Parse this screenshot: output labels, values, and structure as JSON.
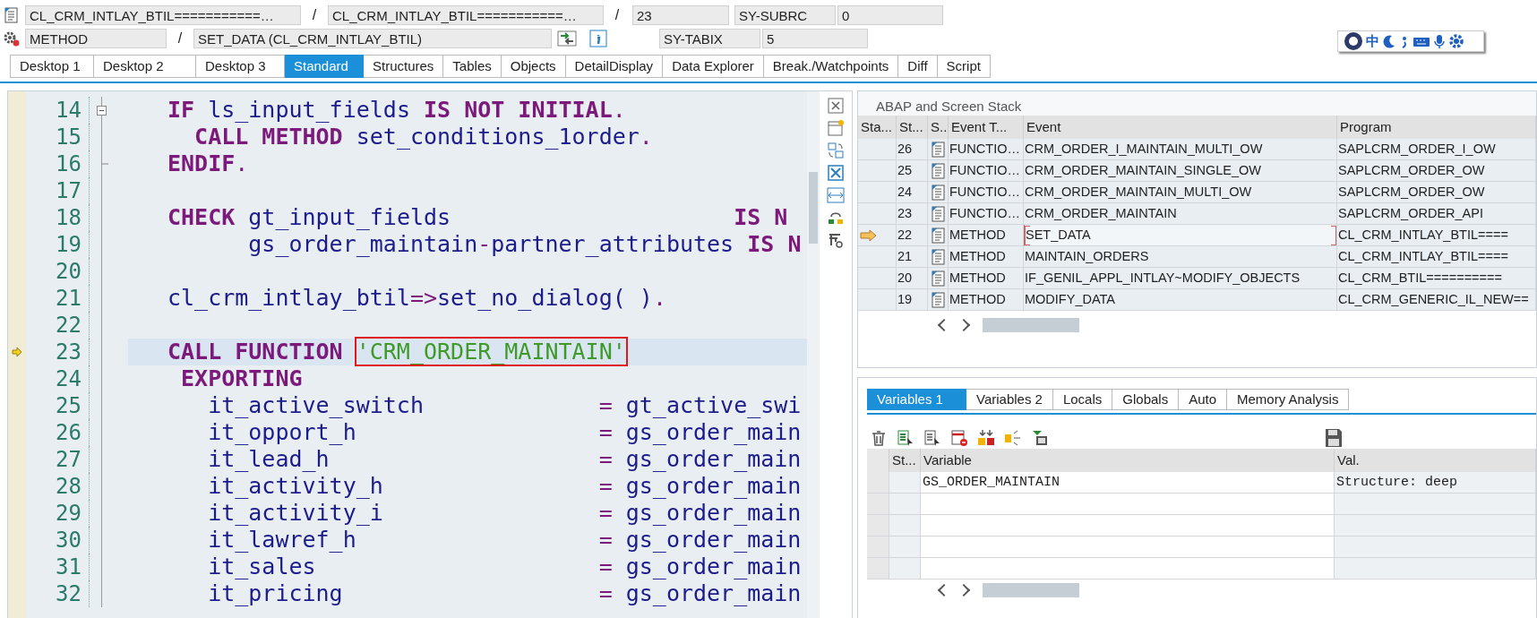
{
  "location": {
    "program": "CL_CRM_INTLAY_BTIL===========…",
    "separator_1": "/",
    "include": "CL_CRM_INTLAY_BTIL===========…",
    "separator_2": "/",
    "line": "23",
    "event_type": "METHOD",
    "separator_3": "/",
    "event": "SET_DATA (CL_CRM_INTLAY_BTIL)"
  },
  "system_fields": [
    {
      "name": "SY-SUBRC",
      "value": "0"
    },
    {
      "name": "SY-TABIX",
      "value": "5"
    }
  ],
  "ime_toolbar": {
    "mode": "中"
  },
  "desktop_tabs": [
    {
      "label": "Desktop 1",
      "selected": false
    },
    {
      "label": "Desktop 2",
      "selected": false
    },
    {
      "label": "Desktop 3",
      "selected": false
    },
    {
      "label": "Standard",
      "selected": true
    },
    {
      "label": "Structures",
      "selected": false
    },
    {
      "label": "Tables",
      "selected": false
    },
    {
      "label": "Objects",
      "selected": false
    },
    {
      "label": "DetailDisplay",
      "selected": false
    },
    {
      "label": "Data Explorer",
      "selected": false
    },
    {
      "label": "Break./Watchpoints",
      "selected": false
    },
    {
      "label": "Diff",
      "selected": false
    },
    {
      "label": "Script",
      "selected": false
    }
  ],
  "editor": {
    "lines": [
      {
        "number": "14",
        "fold_start": true,
        "fold_end": false,
        "current": false,
        "tokens": [
          {
            "kind": "keyword",
            "text": "IF"
          },
          {
            "kind": "ident",
            "text": " ls_input_fields"
          },
          {
            "kind": "keyword",
            "text": " IS NOT INITIAL"
          },
          {
            "kind": "op",
            "text": "."
          }
        ]
      },
      {
        "number": "15",
        "fold_start": false,
        "fold_end": false,
        "current": false,
        "tokens": [
          {
            "kind": "keyword",
            "text": "  CALL METHOD"
          },
          {
            "kind": "ident",
            "text": " set_conditions_1order"
          },
          {
            "kind": "op",
            "text": "."
          }
        ]
      },
      {
        "number": "16",
        "fold_start": false,
        "fold_end": true,
        "current": false,
        "tokens": [
          {
            "kind": "keyword",
            "text": "ENDIF"
          },
          {
            "kind": "op",
            "text": "."
          }
        ]
      },
      {
        "number": "17",
        "fold_start": false,
        "fold_end": false,
        "current": false
      },
      {
        "number": "18",
        "fold_start": false,
        "fold_end": false,
        "current": false,
        "tokens": [
          {
            "kind": "keyword",
            "text": "CHECK"
          },
          {
            "kind": "ident",
            "text": " gt_input_fields"
          },
          {
            "kind": "keyword",
            "text": "                     IS N"
          }
        ]
      },
      {
        "number": "19",
        "fold_start": false,
        "fold_end": false,
        "current": false,
        "tokens": [
          {
            "kind": "ident",
            "text": "      gs_order_maintain"
          },
          {
            "kind": "op",
            "text": "-"
          },
          {
            "kind": "ident",
            "text": "partner_attributes"
          },
          {
            "kind": "keyword",
            "text": " IS N"
          }
        ]
      },
      {
        "number": "20",
        "fold_start": false,
        "fold_end": false,
        "current": false
      },
      {
        "number": "21",
        "fold_start": false,
        "fold_end": false,
        "current": false,
        "tokens": [
          {
            "kind": "ident",
            "text": "cl_crm_intlay_btil"
          },
          {
            "kind": "op",
            "text": "=>"
          },
          {
            "kind": "ident",
            "text": "set_no_dialog( )"
          },
          {
            "kind": "op",
            "text": "."
          }
        ]
      },
      {
        "number": "22",
        "fold_start": false,
        "fold_end": false,
        "current": false
      },
      {
        "number": "23",
        "fold_start": false,
        "fold_end": false,
        "current": true,
        "tokens": [
          {
            "kind": "keyword",
            "text": "CALL FUNCTION "
          },
          {
            "kind": "string",
            "text": "'CRM_ORDER_MAINTAIN'",
            "boxed": true
          }
        ]
      },
      {
        "number": "24",
        "fold_start": false,
        "fold_end": false,
        "current": false,
        "tokens": [
          {
            "kind": "keyword",
            "text": " EXPORTING"
          }
        ]
      },
      {
        "number": "25",
        "fold_start": false,
        "fold_end": false,
        "current": false,
        "tokens": [
          {
            "kind": "ident",
            "text": "   it_active_switch"
          },
          {
            "kind": "op",
            "text": "             ="
          },
          {
            "kind": "ident",
            "text": " gt_active_swi"
          }
        ]
      },
      {
        "number": "26",
        "fold_start": false,
        "fold_end": false,
        "current": false,
        "tokens": [
          {
            "kind": "ident",
            "text": "   it_opport_h"
          },
          {
            "kind": "op",
            "text": "                  ="
          },
          {
            "kind": "ident",
            "text": " gs_order_main"
          }
        ]
      },
      {
        "number": "27",
        "fold_start": false,
        "fold_end": false,
        "current": false,
        "tokens": [
          {
            "kind": "ident",
            "text": "   it_lead_h"
          },
          {
            "kind": "op",
            "text": "                    ="
          },
          {
            "kind": "ident",
            "text": " gs_order_main"
          }
        ]
      },
      {
        "number": "28",
        "fold_start": false,
        "fold_end": false,
        "current": false,
        "tokens": [
          {
            "kind": "ident",
            "text": "   it_activity_h"
          },
          {
            "kind": "op",
            "text": "                ="
          },
          {
            "kind": "ident",
            "text": " gs_order_main"
          }
        ]
      },
      {
        "number": "29",
        "fold_start": false,
        "fold_end": false,
        "current": false,
        "tokens": [
          {
            "kind": "ident",
            "text": "   it_activity_i"
          },
          {
            "kind": "op",
            "text": "                ="
          },
          {
            "kind": "ident",
            "text": " gs_order_main"
          }
        ]
      },
      {
        "number": "30",
        "fold_start": false,
        "fold_end": false,
        "current": false,
        "tokens": [
          {
            "kind": "ident",
            "text": "   it_lawref_h"
          },
          {
            "kind": "op",
            "text": "                  ="
          },
          {
            "kind": "ident",
            "text": " gs_order_main"
          }
        ]
      },
      {
        "number": "31",
        "fold_start": false,
        "fold_end": false,
        "current": false,
        "tokens": [
          {
            "kind": "ident",
            "text": "   it_sales"
          },
          {
            "kind": "op",
            "text": "                     ="
          },
          {
            "kind": "ident",
            "text": " gs_order_main"
          }
        ]
      },
      {
        "number": "32",
        "fold_start": false,
        "fold_end": false,
        "current": false,
        "tokens": [
          {
            "kind": "ident",
            "text": "   it_pricing"
          },
          {
            "kind": "op",
            "text": "                   ="
          },
          {
            "kind": "ident",
            "text": " gs_order_main"
          }
        ]
      }
    ]
  },
  "stack": {
    "title": "ABAP and Screen Stack",
    "columns": [
      "Sta...",
      "St...",
      "S..",
      "Event T...",
      "Event",
      "Program"
    ],
    "rows": [
      {
        "current": false,
        "focused": false,
        "level": "26",
        "event_type": "FUNCTIO…",
        "event": "CRM_ORDER_I_MAINTAIN_MULTI_OW",
        "program": "SAPLCRM_ORDER_I_OW"
      },
      {
        "current": false,
        "focused": false,
        "level": "25",
        "event_type": "FUNCTIO…",
        "event": "CRM_ORDER_MAINTAIN_SINGLE_OW",
        "program": "SAPLCRM_ORDER_OW"
      },
      {
        "current": false,
        "focused": false,
        "level": "24",
        "event_type": "FUNCTIO…",
        "event": "CRM_ORDER_MAINTAIN_MULTI_OW",
        "program": "SAPLCRM_ORDER_OW"
      },
      {
        "current": false,
        "focused": false,
        "level": "23",
        "event_type": "FUNCTIO…",
        "event": "CRM_ORDER_MAINTAIN",
        "program": "SAPLCRM_ORDER_API"
      },
      {
        "current": true,
        "focused": true,
        "level": "22",
        "event_type": "METHOD",
        "event": "SET_DATA",
        "program": "CL_CRM_INTLAY_BTIL===="
      },
      {
        "current": false,
        "focused": false,
        "level": "21",
        "event_type": "METHOD",
        "event": "MAINTAIN_ORDERS",
        "program": "CL_CRM_INTLAY_BTIL===="
      },
      {
        "current": false,
        "focused": false,
        "level": "20",
        "event_type": "METHOD",
        "event": "IF_GENIL_APPL_INTLAY~MODIFY_OBJECTS",
        "program": "CL_CRM_BTIL=========="
      },
      {
        "current": false,
        "focused": false,
        "level": "19",
        "event_type": "METHOD",
        "event": "MODIFY_DATA",
        "program": "CL_CRM_GENERIC_IL_NEW=="
      }
    ]
  },
  "variables": {
    "tabs": [
      {
        "label": "Variables 1",
        "selected": true
      },
      {
        "label": "Variables 2",
        "selected": false
      },
      {
        "label": "Locals",
        "selected": false
      },
      {
        "label": "Globals",
        "selected": false
      },
      {
        "label": "Auto",
        "selected": false
      },
      {
        "label": "Memory Analysis",
        "selected": false
      }
    ],
    "columns": [
      "St...",
      "Variable",
      "Val."
    ],
    "rows": [
      {
        "variable": "GS_ORDER_MAINTAIN",
        "value": "Structure: deep"
      }
    ]
  }
}
